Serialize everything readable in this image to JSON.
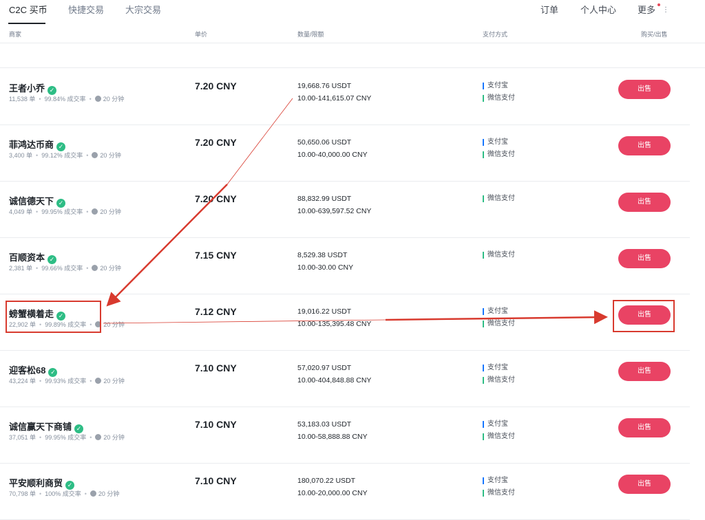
{
  "topnav": {
    "tabs": [
      {
        "label": "C2C 买币",
        "active": true
      },
      {
        "label": "快捷交易",
        "active": false
      },
      {
        "label": "大宗交易",
        "active": false
      }
    ],
    "links": {
      "orders": "订单",
      "profile": "个人中心",
      "more": "更多"
    }
  },
  "table": {
    "headers": {
      "merchant": "商家",
      "price": "单价",
      "amount": "数量/限额",
      "payment": "支付方式",
      "action": "购买/出售"
    },
    "rows": [
      {
        "name": "王者小乔",
        "orders": "11,538 单",
        "completion": "99.84% 成交率",
        "time": "20 分钟",
        "price": "7.20 CNY",
        "amount": "19,668.76 USDT",
        "limit": "10.00-141,615.07 CNY",
        "payments": [
          "支付宝",
          "微信支付"
        ],
        "button": "出售"
      },
      {
        "name": "菲鸿达币商",
        "orders": "3,400 单",
        "completion": "99.12% 成交率",
        "time": "20 分钟",
        "price": "7.20 CNY",
        "amount": "50,650.06 USDT",
        "limit": "10.00-40,000.00 CNY",
        "payments": [
          "支付宝",
          "微信支付"
        ],
        "button": "出售"
      },
      {
        "name": "诚信德天下",
        "orders": "4,049 单",
        "completion": "99.95% 成交率",
        "time": "20 分钟",
        "price": "7.20 CNY",
        "amount": "88,832.99 USDT",
        "limit": "10.00-639,597.52 CNY",
        "payments": [
          "微信支付"
        ],
        "button": "出售"
      },
      {
        "name": "百顺资本",
        "orders": "2,381 单",
        "completion": "99.66% 成交率",
        "time": "20 分钟",
        "price": "7.15 CNY",
        "amount": "8,529.38 USDT",
        "limit": "10.00-30.00 CNY",
        "payments": [
          "微信支付"
        ],
        "button": "出售"
      },
      {
        "name": "螃蟹横着走",
        "orders": "22,902 单",
        "completion": "99.89% 成交率",
        "time": "20 分钟",
        "price": "7.12 CNY",
        "amount": "19,016.22 USDT",
        "limit": "10.00-135,395.48 CNY",
        "payments": [
          "支付宝",
          "微信支付"
        ],
        "button": "出售"
      },
      {
        "name": "迎客松68",
        "orders": "43,224 单",
        "completion": "99.93% 成交率",
        "time": "20 分钟",
        "price": "7.10 CNY",
        "amount": "57,020.97 USDT",
        "limit": "10.00-404,848.88 CNY",
        "payments": [
          "支付宝",
          "微信支付"
        ],
        "button": "出售"
      },
      {
        "name": "诚信赢天下商铺",
        "orders": "37,051 单",
        "completion": "99.95% 成交率",
        "time": "20 分钟",
        "price": "7.10 CNY",
        "amount": "53,183.03 USDT",
        "limit": "10.00-58,888.88 CNY",
        "payments": [
          "支付宝",
          "微信支付"
        ],
        "button": "出售"
      },
      {
        "name": "平安顺利商贸",
        "orders": "70,798 单",
        "completion": "100% 成交率",
        "time": "20 分钟",
        "price": "7.10 CNY",
        "amount": "180,070.22 USDT",
        "limit": "10.00-20,000.00 CNY",
        "payments": [
          "支付宝",
          "微信支付"
        ],
        "button": "出售"
      }
    ]
  },
  "colors": {
    "sell_button": "#e94364",
    "annotation": "#d83a2e",
    "verified_badge": "#2ebd85"
  },
  "icons": {
    "verified": "verified-badge-icon",
    "clock": "clock-icon",
    "more": "more-menu-icon"
  }
}
